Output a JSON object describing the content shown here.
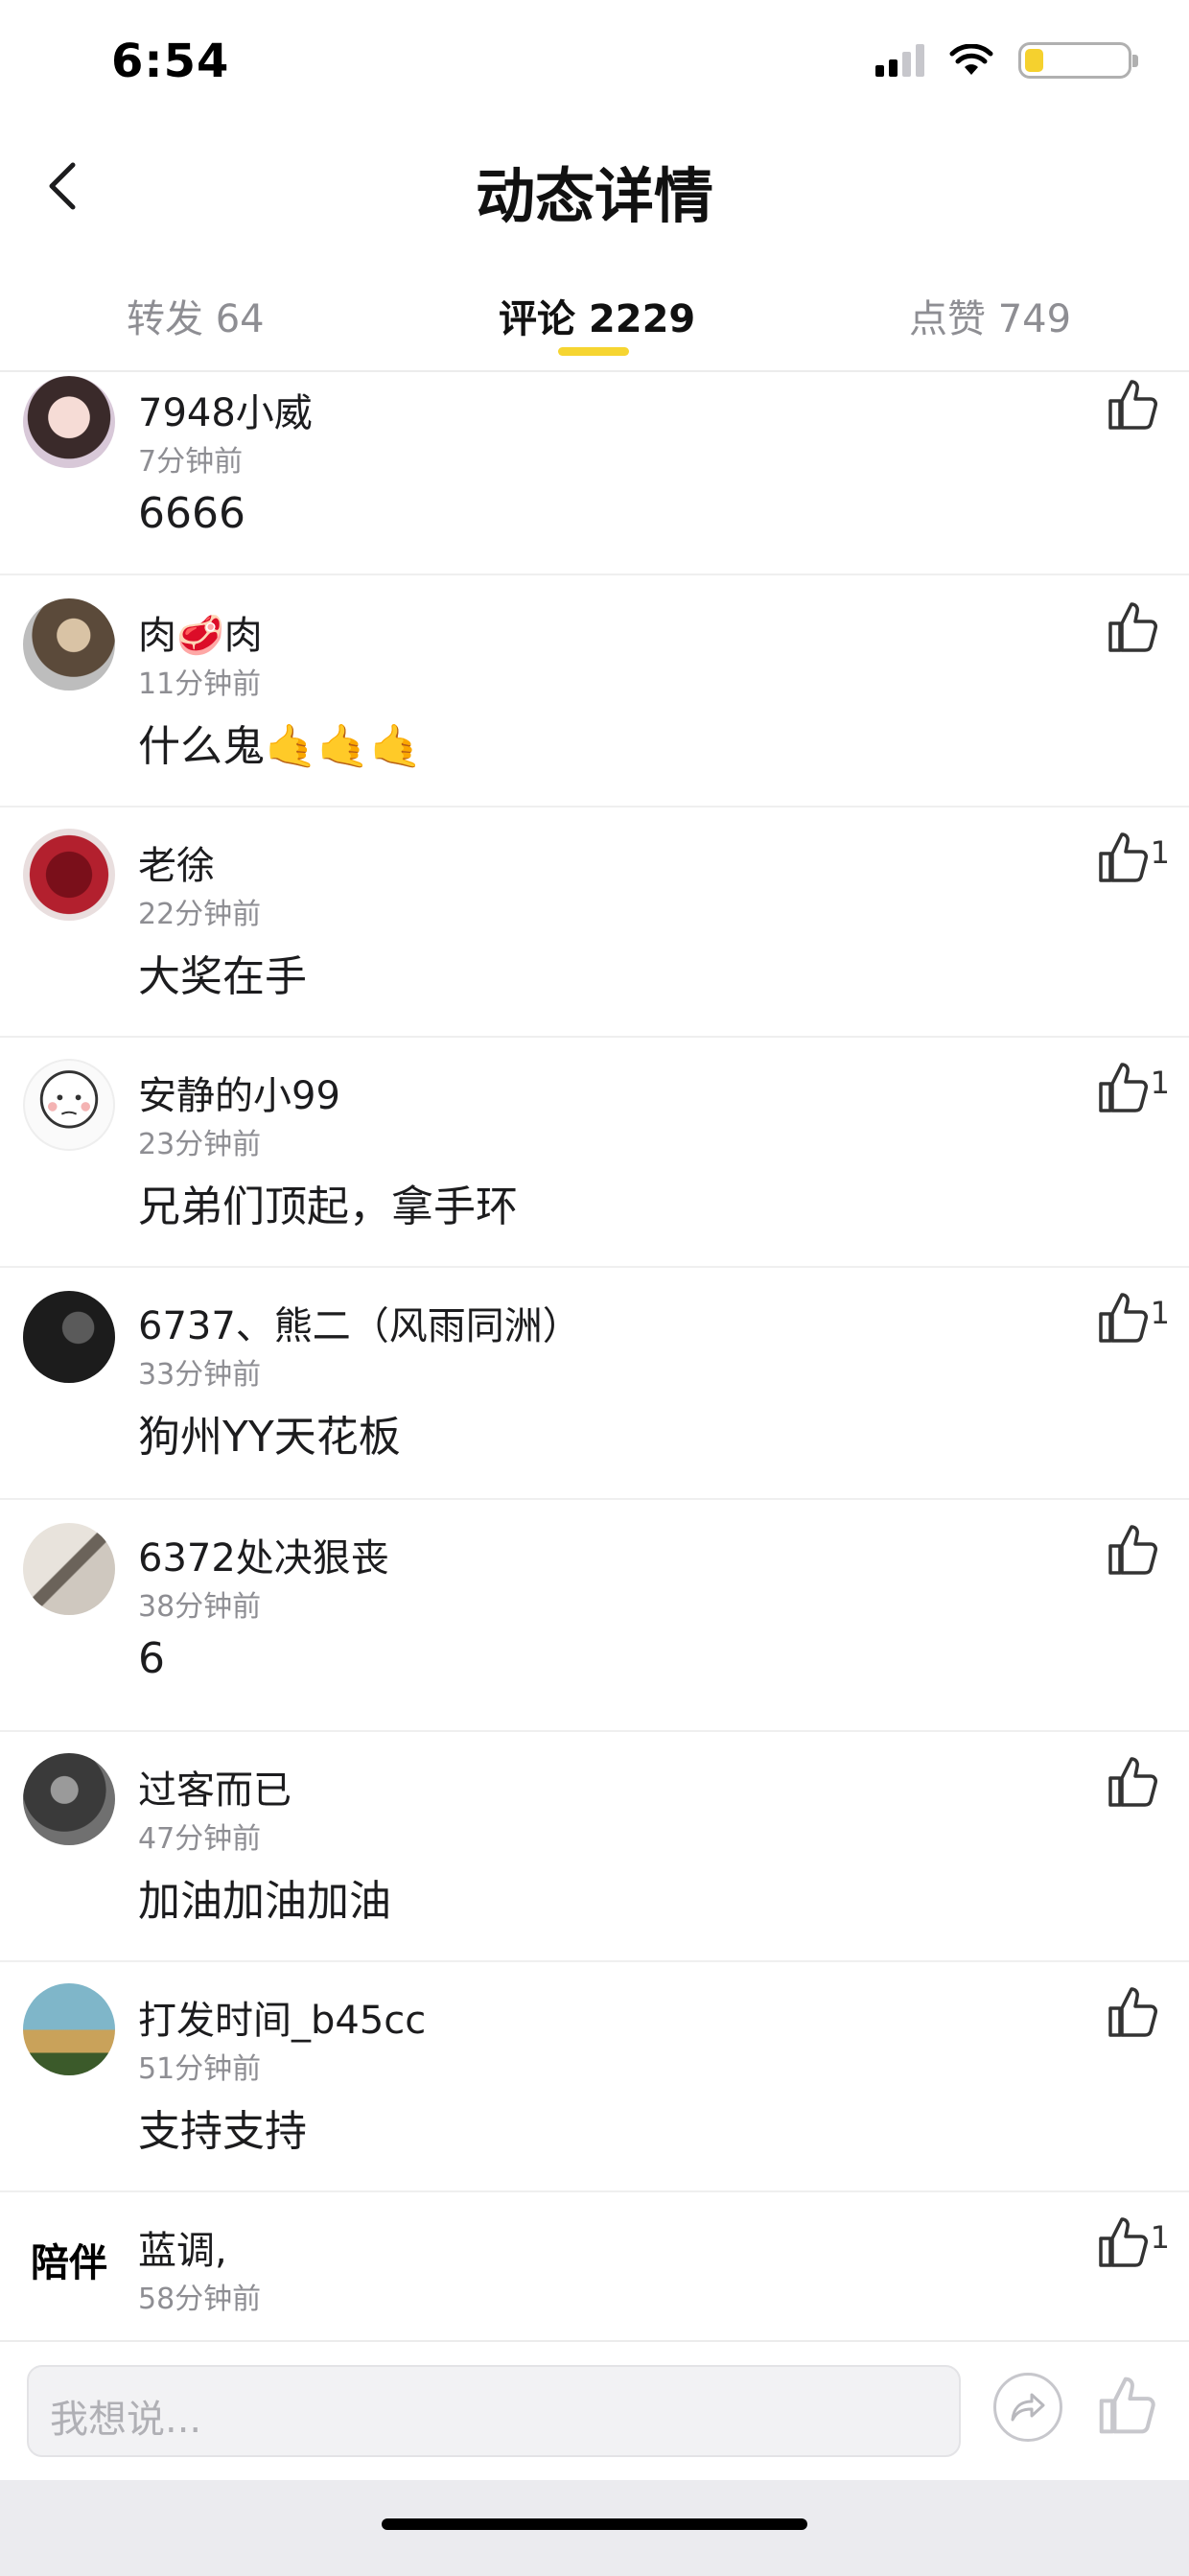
{
  "status_bar": {
    "time": "6:54",
    "battery_level": 0.18
  },
  "nav": {
    "title": "动态详情",
    "back_icon": "chevron-left-icon"
  },
  "tabs": [
    {
      "label": "转发 64",
      "active": false
    },
    {
      "label": "评论 2229",
      "active": true
    },
    {
      "label": "点赞 749",
      "active": false
    }
  ],
  "comments": [
    {
      "name": "7948小威",
      "time": "7分钟前",
      "text": "6666",
      "likes": ""
    },
    {
      "name": "肉🥩肉",
      "time": "11分钟前",
      "text": "什么鬼🤙🤙🤙",
      "likes": ""
    },
    {
      "name": "老徐",
      "time": "22分钟前",
      "text": "大奖在手",
      "likes": "1"
    },
    {
      "name": "安静的小99",
      "time": "23分钟前",
      "text": "兄弟们顶起，拿手环",
      "likes": "1"
    },
    {
      "name": "6737、熊二（风雨同洲）",
      "time": "33分钟前",
      "text": "狗州YY天花板",
      "likes": "1"
    },
    {
      "name": "6372处决狠丧",
      "time": "38分钟前",
      "text": "6",
      "likes": ""
    },
    {
      "name": "过客而已",
      "time": "47分钟前",
      "text": "加油加油加油",
      "likes": ""
    },
    {
      "name": "打发时间_b45cc",
      "time": "51分钟前",
      "text": "支持支持",
      "likes": ""
    },
    {
      "name": "蓝调,",
      "time": "58分钟前",
      "text": "",
      "likes": "1",
      "avatar_text": "陪伴"
    }
  ],
  "bottom_bar": {
    "placeholder": "我想说...",
    "share_icon": "share-icon",
    "like_icon": "thumbs-up-icon"
  },
  "colors": {
    "accent": "#f6d531",
    "muted": "#8e8e93"
  }
}
